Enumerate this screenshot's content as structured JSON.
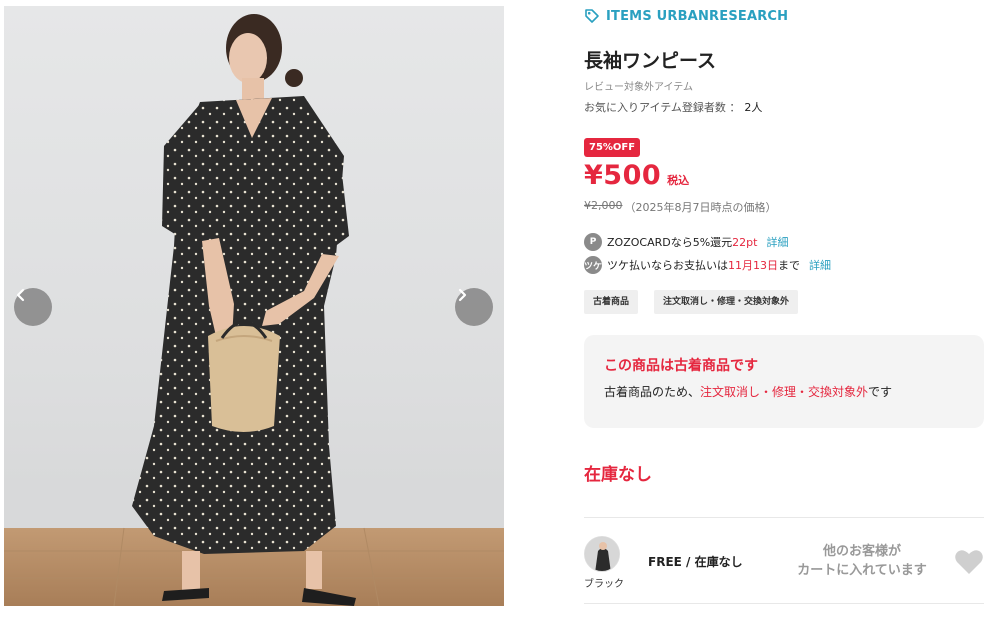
{
  "gallery": {
    "prev_label": "previous-image",
    "next_label": "next-image"
  },
  "brand": {
    "label": "ITEMS URBANRESEARCH",
    "icon": "tag-icon",
    "color": "#2aa0c0"
  },
  "product": {
    "title": "長袖ワンピース",
    "review_note": "レビュー対象外アイテム",
    "favorites_label": "お気に入りアイテム登録者数 ：",
    "favorites_count": "2人"
  },
  "pricing": {
    "discount_badge": "75%OFF",
    "price": "¥500",
    "tax_label": "税込",
    "original_price": "¥2,000",
    "original_note": "（2025年8月7日時点の価格）",
    "accent_color": "#e5273f"
  },
  "benefits": [
    {
      "icon_text": "P",
      "prefix": "ZOZOCARDなら5%還元",
      "highlight": "22pt",
      "suffix": "",
      "link": "詳細"
    },
    {
      "icon_text": "ツケ",
      "prefix": "ツケ払いならお支払いは",
      "highlight": "11月13日",
      "suffix": "まで",
      "link": "詳細"
    }
  ],
  "tags": [
    "古着商品",
    "注文取消し・修理・交換対象外"
  ],
  "notice": {
    "title": "この商品は古着商品です",
    "body_prefix": "古着商品のため、",
    "body_highlight": "注文取消し・修理・交換対象外",
    "body_suffix": "です"
  },
  "stock_status": "在庫なし",
  "variant": {
    "color_name": "ブラック",
    "size_stock": "FREE / 在庫なし",
    "cart_note_line1": "他のお客様が",
    "cart_note_line2": "カートに入れています",
    "favorite_icon": "heart-icon"
  }
}
